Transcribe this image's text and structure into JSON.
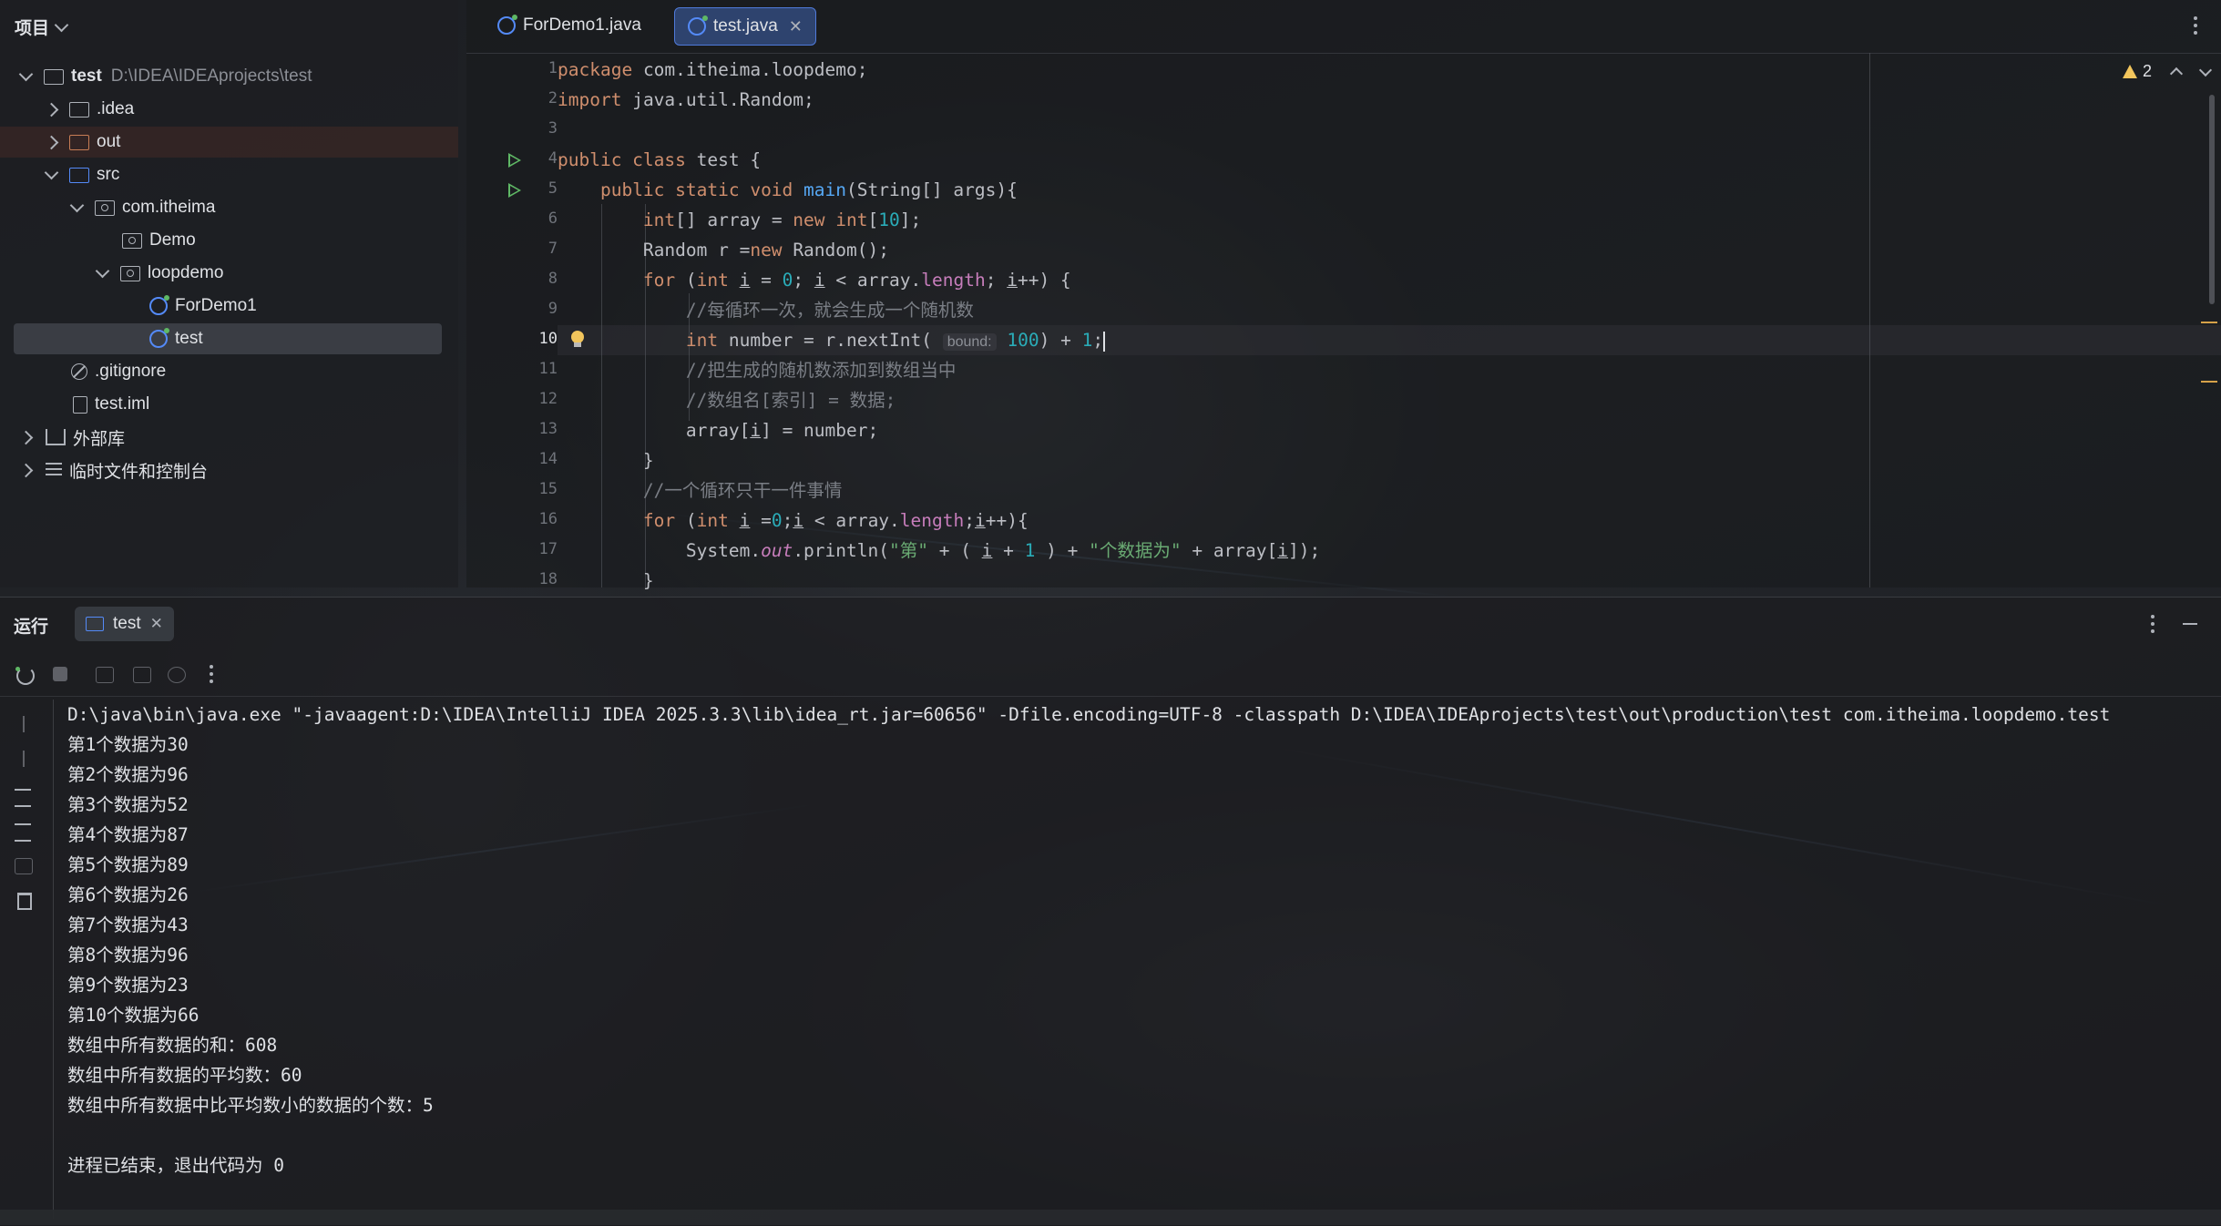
{
  "project": {
    "header": "项目",
    "tree": [
      {
        "label": "test",
        "extra": "D:\\IDEA\\IDEAprojects\\test"
      },
      {
        "label": ".idea"
      },
      {
        "label": "out"
      },
      {
        "label": "src"
      },
      {
        "label": "com.itheima"
      },
      {
        "label": "Demo"
      },
      {
        "label": "loopdemo"
      },
      {
        "label": "ForDemo1"
      },
      {
        "label": "test"
      },
      {
        "label": ".gitignore"
      },
      {
        "label": "test.iml"
      },
      {
        "label": "外部库"
      },
      {
        "label": "临时文件和控制台"
      }
    ]
  },
  "editor": {
    "tabs": [
      {
        "label": "ForDemo1.java"
      },
      {
        "label": "test.java",
        "close": "✕"
      }
    ],
    "warnings_count": "2",
    "line_numbers": [
      "1",
      "2",
      "3",
      "4",
      "5",
      "6",
      "7",
      "8",
      "9",
      "10",
      "11",
      "12",
      "13",
      "14",
      "15",
      "16",
      "17",
      "18"
    ],
    "inlay_hint": "bound:"
  },
  "run": {
    "title": "运行",
    "tab_label": "test",
    "tab_close": "✕",
    "console_lines": [
      "D:\\java\\bin\\java.exe \"-javaagent:D:\\IDEA\\IntelliJ IDEA 2025.3.3\\lib\\idea_rt.jar=60656\" -Dfile.encoding=UTF-8 -classpath D:\\IDEA\\IDEAprojects\\test\\out\\production\\test com.itheima.loopdemo.test",
      "第1个数据为30",
      "第2个数据为96",
      "第3个数据为52",
      "第4个数据为87",
      "第5个数据为89",
      "第6个数据为26",
      "第7个数据为43",
      "第8个数据为96",
      "第9个数据为23",
      "第10个数据为66",
      "数组中所有数据的和：608",
      "数组中所有数据的平均数：60",
      "数组中所有数据中比平均数小的数据的个数：5",
      "",
      "进程已结束，退出代码为 0"
    ]
  },
  "colors": {
    "accent": "#548af7",
    "keyword": "#cf8e6d",
    "string": "#6aab73",
    "number": "#2aacb8",
    "comment": "#7a7e85",
    "run_green": "#5fb865",
    "warning": "#f2c55c"
  },
  "icons": [
    "folder-icon",
    "package-icon",
    "class-icon",
    "file-icon",
    "gitignore-icon",
    "library-icon",
    "scratch-icon",
    "run-gutter-icon",
    "bulb-icon",
    "warning-icon",
    "rerun-icon",
    "stop-icon",
    "trash-icon",
    "more-icon",
    "minimize-icon"
  ]
}
